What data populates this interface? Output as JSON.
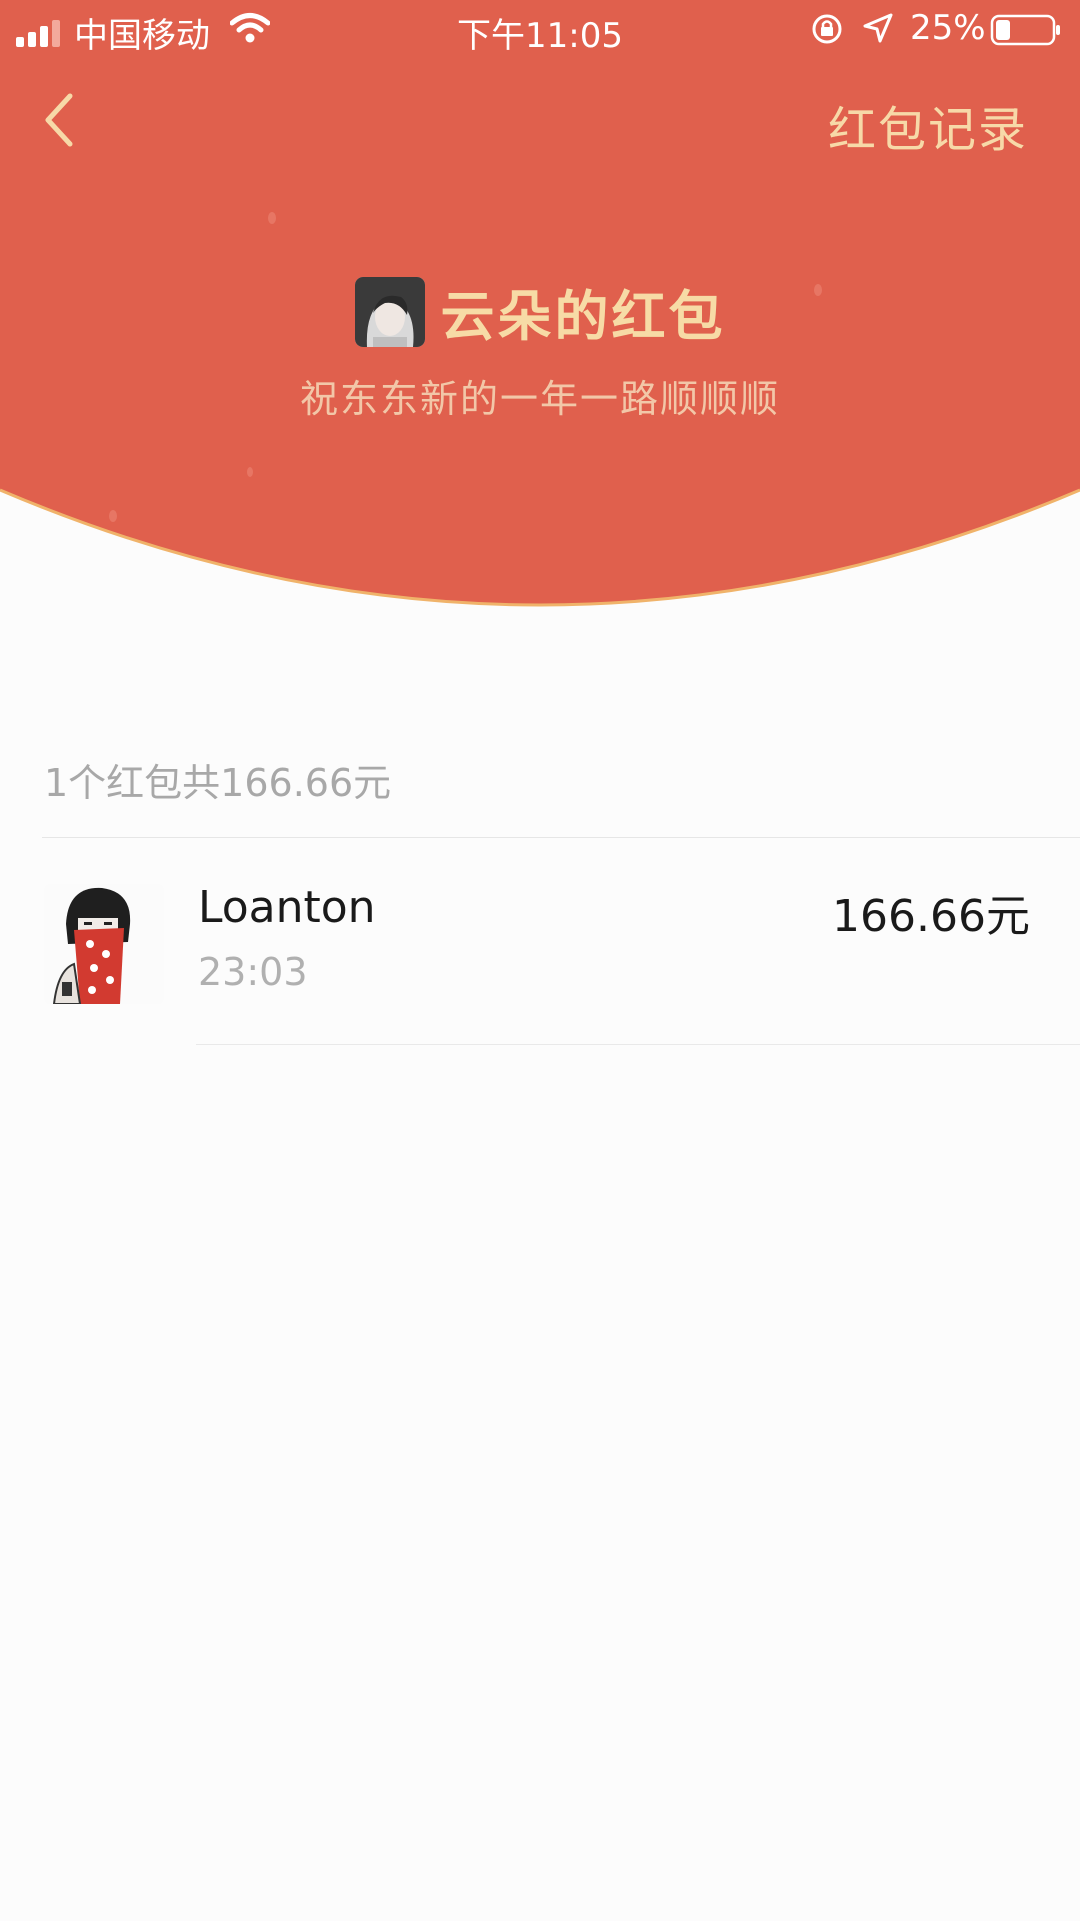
{
  "status_bar": {
    "carrier": "中国移动",
    "time": "下午11:05",
    "battery_percent": "25%",
    "battery_level": 0.25
  },
  "nav": {
    "back_icon": "chevron-left-icon",
    "records_label": "红包记录"
  },
  "envelope": {
    "sender_title": "云朵的红包",
    "greeting": "祝东东新的一年一路顺顺顺"
  },
  "summary": {
    "text": "1个红包共166.66元"
  },
  "records": [
    {
      "name": "Loanton",
      "time": "23:03",
      "amount": "166.66元"
    }
  ],
  "colors": {
    "header_red": "#e0604d",
    "gold_text": "#f7dba6",
    "arc_edge": "#f0b36a"
  }
}
